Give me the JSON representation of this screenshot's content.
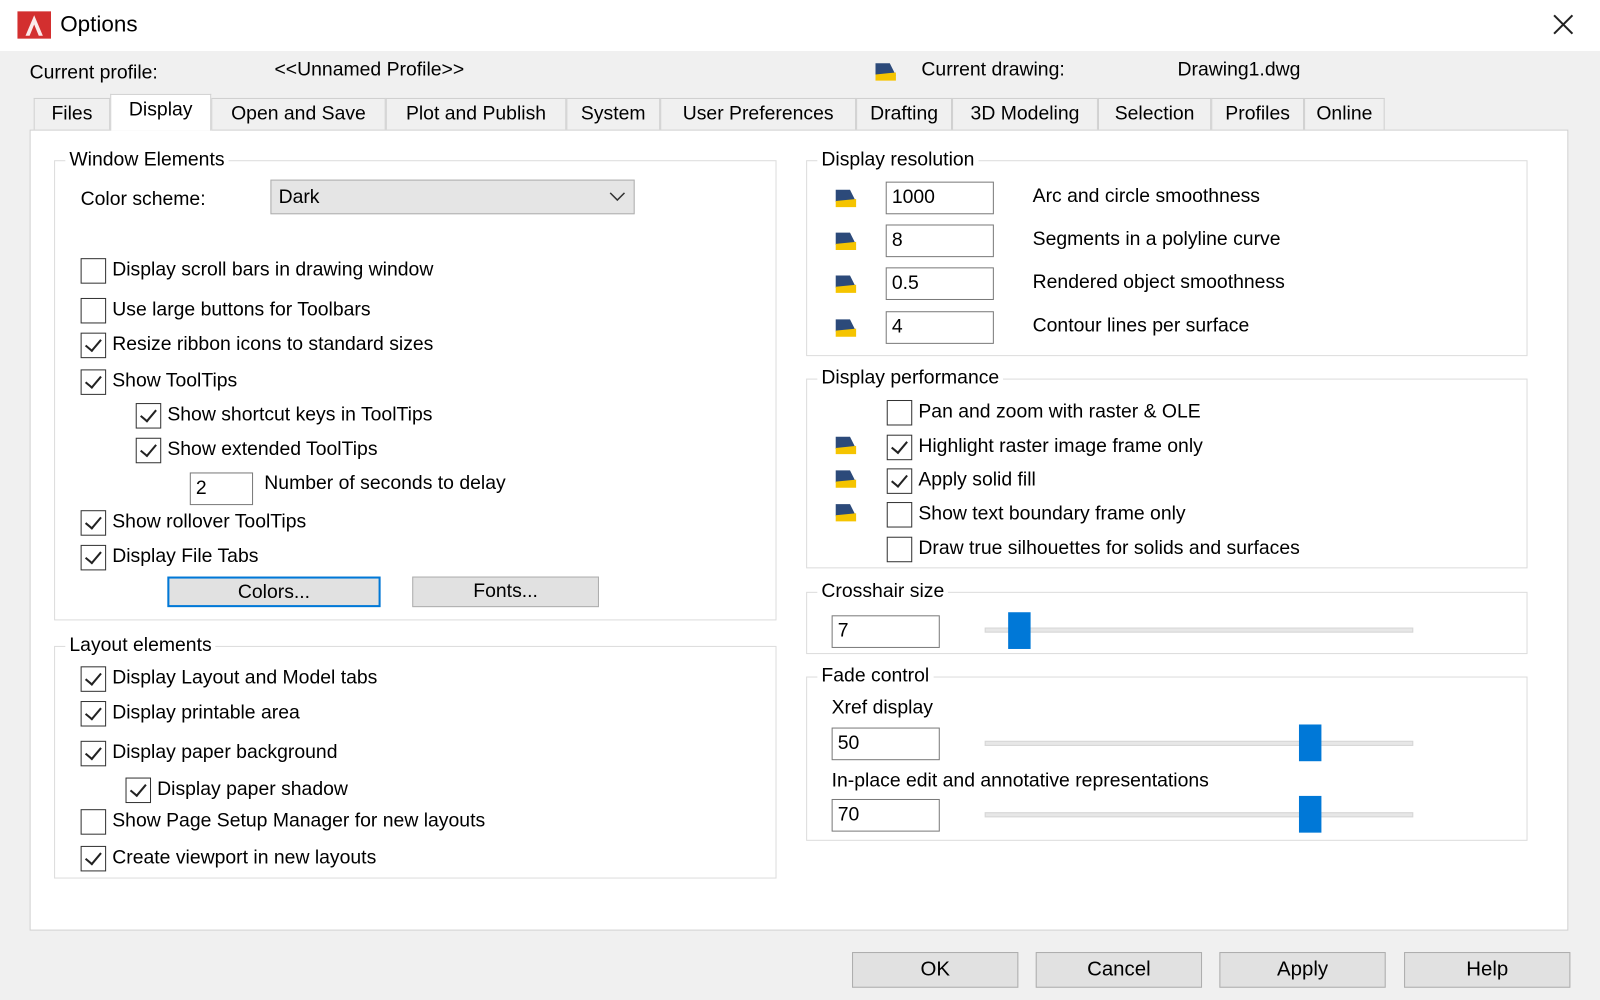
{
  "window": {
    "title": "Options",
    "close_icon": "close-icon"
  },
  "header": {
    "profile_label": "Current profile:",
    "profile_value": "<<Unnamed Profile>>",
    "drawing_label": "Current drawing:",
    "drawing_value": "Drawing1.dwg"
  },
  "tabs": [
    "Files",
    "Display",
    "Open and Save",
    "Plot and Publish",
    "System",
    "User Preferences",
    "Drafting",
    "3D Modeling",
    "Selection",
    "Profiles",
    "Online"
  ],
  "selected_tab": "Display",
  "window_elements": {
    "title": "Window Elements",
    "color_scheme_label": "Color scheme:",
    "color_scheme_value": "Dark",
    "checkboxes": [
      {
        "label": "Display scroll bars in drawing window",
        "checked": false
      },
      {
        "label": "Use large buttons for Toolbars",
        "checked": false
      },
      {
        "label": "Resize ribbon icons to standard sizes",
        "checked": true
      },
      {
        "label": "Show ToolTips",
        "checked": true
      },
      {
        "label": "Show shortcut keys in ToolTips",
        "checked": true
      },
      {
        "label": "Show extended ToolTips",
        "checked": true
      },
      {
        "label": "Show rollover ToolTips",
        "checked": true
      },
      {
        "label": "Display File Tabs",
        "checked": true
      }
    ],
    "delay_value": "2",
    "delay_label": "Number of seconds to delay",
    "colors_button": "Colors...",
    "fonts_button": "Fonts..."
  },
  "layout_elements": {
    "title": "Layout elements",
    "checkboxes": [
      {
        "label": "Display Layout and Model tabs",
        "checked": true
      },
      {
        "label": "Display printable area",
        "checked": true
      },
      {
        "label": "Display paper background",
        "checked": true
      },
      {
        "label": "Display paper shadow",
        "checked": true
      },
      {
        "label": "Show Page Setup Manager for new layouts",
        "checked": false
      },
      {
        "label": "Create viewport in new layouts",
        "checked": true
      }
    ]
  },
  "display_resolution": {
    "title": "Display resolution",
    "rows": [
      {
        "value": "1000",
        "label": "Arc and circle smoothness"
      },
      {
        "value": "8",
        "label": "Segments in a polyline curve"
      },
      {
        "value": "0.5",
        "label": "Rendered object smoothness"
      },
      {
        "value": "4",
        "label": "Contour lines per surface"
      }
    ]
  },
  "display_performance": {
    "title": "Display performance",
    "checkboxes": [
      {
        "label": "Pan and zoom with raster & OLE",
        "checked": false
      },
      {
        "label": "Highlight raster image frame only",
        "checked": true
      },
      {
        "label": "Apply solid fill",
        "checked": true
      },
      {
        "label": "Show text boundary frame only",
        "checked": false
      },
      {
        "label": "Draw true silhouettes for solids and surfaces",
        "checked": false
      }
    ]
  },
  "crosshair": {
    "title": "Crosshair size",
    "value": "7",
    "slider_fraction": 0.08
  },
  "fade_control": {
    "title": "Fade control",
    "xref_label": "Xref display",
    "xref_value": "50",
    "xref_slider_fraction": 0.76,
    "inplace_label": "In-place edit and annotative representations",
    "inplace_value": "70",
    "inplace_slider_fraction": 0.76
  },
  "footer": {
    "ok": "OK",
    "cancel": "Cancel",
    "apply": "Apply",
    "help": "Help"
  },
  "colors": {
    "accent": "#0078d7",
    "logo": "#c62828"
  }
}
